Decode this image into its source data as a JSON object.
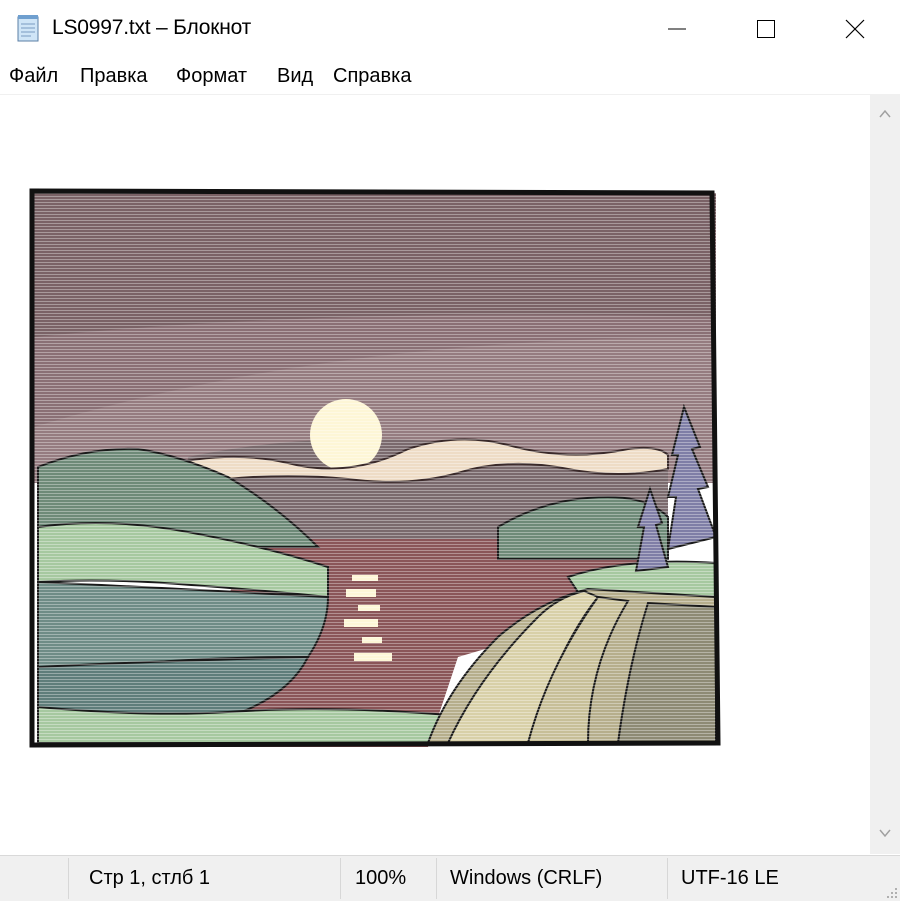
{
  "window": {
    "title": "LS0997.txt – Блокнот",
    "buttons": {
      "minimize": "minimize-icon",
      "maximize": "maximize-icon",
      "close": "close-icon"
    }
  },
  "menu": {
    "items": [
      "Файл",
      "Правка",
      "Формат",
      "Вид",
      "Справка"
    ]
  },
  "editor": {
    "content_description_icon": "ascii-art-landscape-image"
  },
  "statusbar": {
    "position": "Стр 1, стлб 1",
    "zoom": "100%",
    "line_endings": "Windows (CRLF)",
    "encoding": "UTF-16 LE"
  },
  "colors": {
    "sky": "#7a6266",
    "clouds": "#eedcc6",
    "moon": "#fdf6d6",
    "hills_green": "#6e8a78",
    "light_green": "#a6c8a0",
    "water": "#8a5558",
    "cliff": "#cfc6a0",
    "tree": "#7f7ea6"
  }
}
